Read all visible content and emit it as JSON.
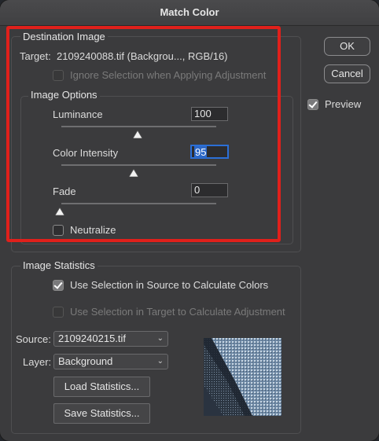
{
  "dialog": {
    "title": "Match Color"
  },
  "destination": {
    "legend": "Destination Image",
    "target_label": "Target:",
    "target_value": "2109240088.tif (Backgrou..., RGB/16)",
    "ignore_selection_label": "Ignore Selection when Applying Adjustment",
    "ignore_selection_checked": false
  },
  "image_options": {
    "legend": "Image Options",
    "luminance": {
      "label": "Luminance",
      "value": "100",
      "slider_fraction": 0.5
    },
    "color_intensity": {
      "label": "Color Intensity",
      "value": "95",
      "slider_fraction": 0.475
    },
    "fade": {
      "label": "Fade",
      "value": "0",
      "slider_fraction": 0.0
    },
    "neutralize_label": "Neutralize",
    "neutralize_checked": false
  },
  "buttons": {
    "ok": "OK",
    "cancel": "Cancel"
  },
  "preview": {
    "label": "Preview",
    "checked": true
  },
  "statistics": {
    "legend": "Image Statistics",
    "use_source_label": "Use Selection in Source to Calculate Colors",
    "use_source_checked": true,
    "use_target_label": "Use Selection in Target to Calculate Adjustment",
    "use_target_checked": false,
    "source_label": "Source:",
    "source_value": "2109240215.tif",
    "layer_label": "Layer:",
    "layer_value": "Background",
    "load_label": "Load Statistics...",
    "save_label": "Save Statistics..."
  },
  "colors": {
    "highlight_box": "#e0201b",
    "focus": "#2b6fd6"
  }
}
